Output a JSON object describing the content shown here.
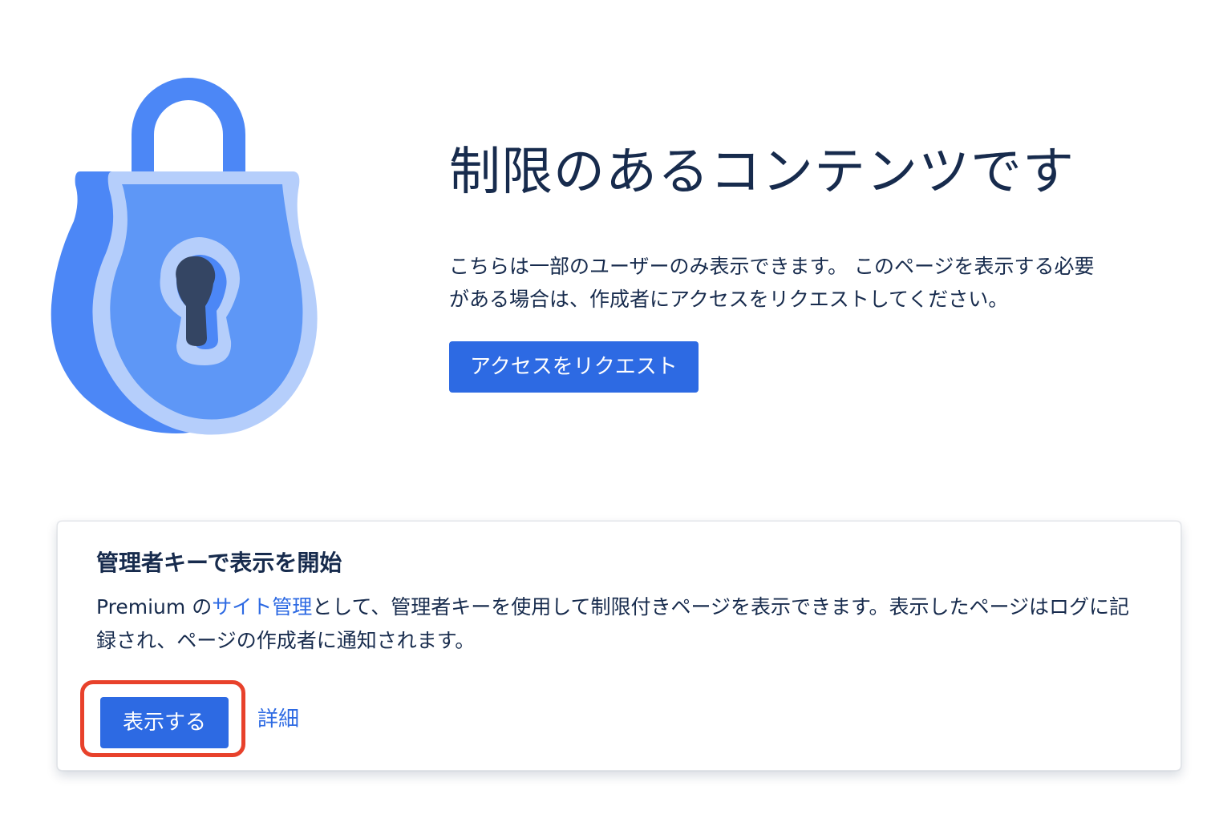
{
  "hero": {
    "title": "制限のあるコンテンツです",
    "description": "こちらは一部のユーザーのみ表示できます。 このページを表示する必要がある場合は、作成者にアクセスをリクエストしてください。",
    "request_button": "アクセスをリクエスト",
    "illustration_icon": "padlock-icon"
  },
  "admin_card": {
    "title": "管理者キーで表示を開始",
    "desc_prefix": "Premium の",
    "desc_link": "サイト管理",
    "desc_suffix": "として、管理者キーを使用して制限付きページを表示できます。表示したページはログに記録され、ページの作成者に通知されます。",
    "view_button": "表示する",
    "details_link": "詳細"
  },
  "colors": {
    "primary": "#2d6ae3",
    "text": "#172b4d",
    "highlight": "#e8412b",
    "lock_dark": "#4c87f6",
    "lock_mid": "#5e97f6",
    "lock_light": "#b5cefb",
    "keyhole": "#344563"
  }
}
